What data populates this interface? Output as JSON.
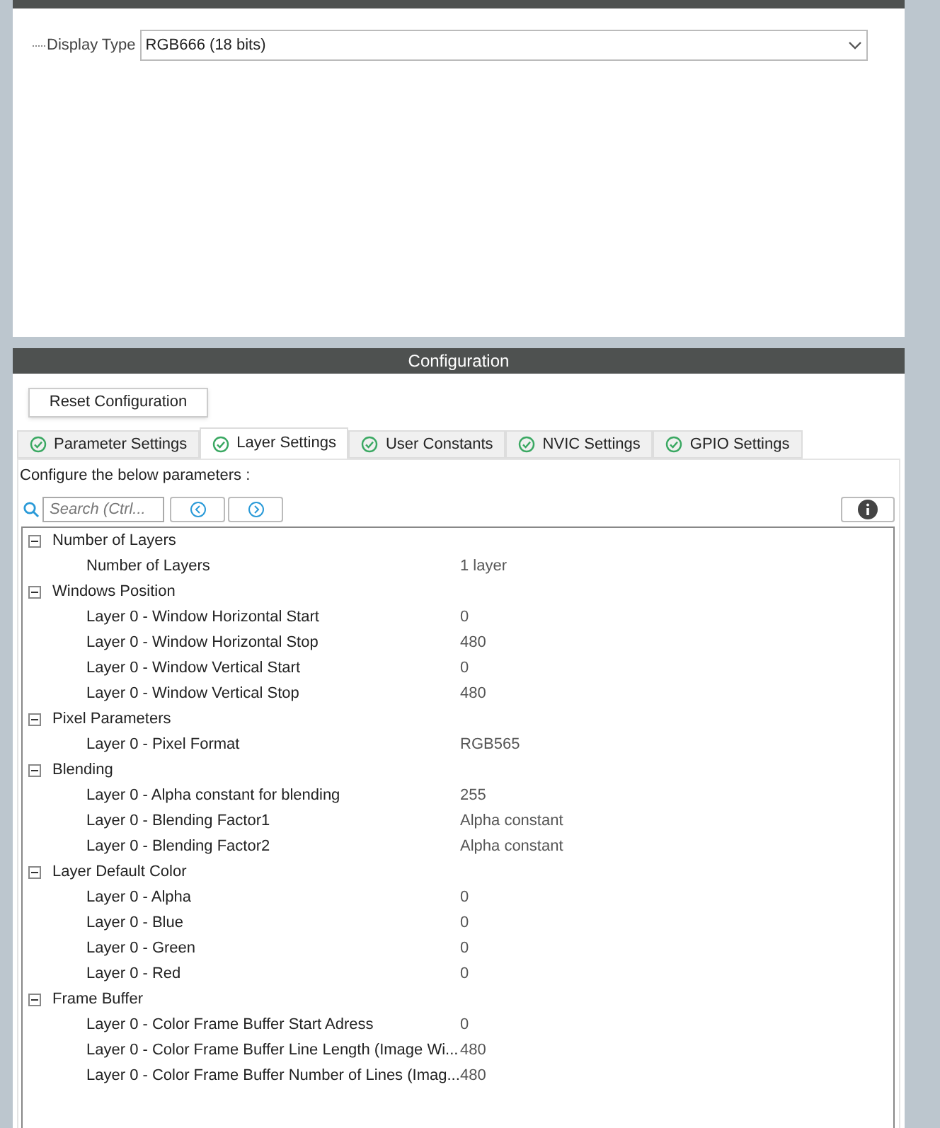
{
  "mode_panel": {
    "display_type": {
      "label": "Display Type",
      "value": "RGB666 (18 bits)"
    }
  },
  "configuration": {
    "title": "Configuration",
    "reset_button": "Reset Configuration",
    "tabs": [
      {
        "label": "Parameter Settings",
        "selected": false
      },
      {
        "label": "Layer Settings",
        "selected": true
      },
      {
        "label": "User Constants",
        "selected": false
      },
      {
        "label": "NVIC Settings",
        "selected": false
      },
      {
        "label": "GPIO Settings",
        "selected": false
      }
    ],
    "instruction": "Configure the below parameters :",
    "search": {
      "placeholder": "Search (Ctrl..."
    },
    "tree": [
      {
        "label": "Number of Layers",
        "expanded": true,
        "children": [
          {
            "label": "Number of Layers",
            "value": "1 layer"
          }
        ]
      },
      {
        "label": "Windows Position",
        "expanded": true,
        "children": [
          {
            "label": "Layer 0 - Window Horizontal Start",
            "value": "0"
          },
          {
            "label": "Layer 0 - Window Horizontal Stop",
            "value": "480"
          },
          {
            "label": "Layer 0 - Window Vertical Start",
            "value": "0"
          },
          {
            "label": "Layer 0 - Window Vertical Stop",
            "value": "480"
          }
        ]
      },
      {
        "label": "Pixel Parameters",
        "expanded": true,
        "children": [
          {
            "label": "Layer 0 - Pixel Format",
            "value": "RGB565"
          }
        ]
      },
      {
        "label": "Blending",
        "expanded": true,
        "children": [
          {
            "label": "Layer 0 - Alpha constant for blending",
            "value": "255"
          },
          {
            "label": "Layer 0 - Blending Factor1",
            "value": "Alpha constant"
          },
          {
            "label": "Layer 0 - Blending Factor2",
            "value": "Alpha constant"
          }
        ]
      },
      {
        "label": "Layer Default Color",
        "expanded": true,
        "children": [
          {
            "label": "Layer 0 - Alpha",
            "value": "0"
          },
          {
            "label": "Layer 0 - Blue",
            "value": "0"
          },
          {
            "label": "Layer 0 - Green",
            "value": "0"
          },
          {
            "label": "Layer 0 - Red",
            "value": "0"
          }
        ]
      },
      {
        "label": "Frame Buffer",
        "expanded": true,
        "children": [
          {
            "label": "Layer 0 - Color Frame Buffer Start Adress",
            "value": "0"
          },
          {
            "label": "Layer 0 - Color Frame Buffer Line Length (Image Wi...",
            "value": "480"
          },
          {
            "label": "Layer 0 - Color Frame Buffer Number of Lines (Imag...",
            "value": "480"
          }
        ]
      }
    ]
  }
}
